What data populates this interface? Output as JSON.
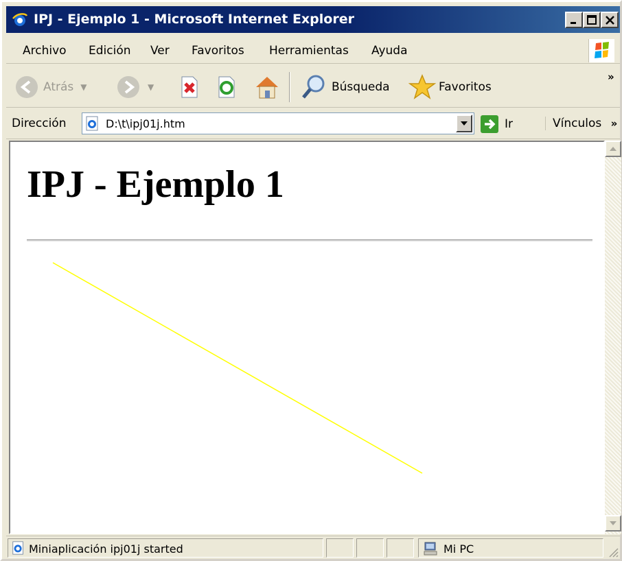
{
  "window": {
    "title": "IPJ - Ejemplo 1 - Microsoft Internet Explorer"
  },
  "menu": {
    "items": [
      "Archivo",
      "Edición",
      "Ver",
      "Favoritos",
      "Herramientas",
      "Ayuda"
    ]
  },
  "toolbar": {
    "back_label": "Atrás",
    "search_label": "Búsqueda",
    "favorites_label": "Favoritos",
    "more": "»"
  },
  "address": {
    "label": "Dirección",
    "url": "D:\\t\\ipj01j.htm",
    "go_label": "Ir",
    "links_label": "Vínculos",
    "more": "»"
  },
  "page": {
    "heading": "IPJ - Ejemplo 1",
    "applet_line_color": "#ffff00"
  },
  "status": {
    "message": "Miniaplicación ipj01j started",
    "zone": "Mi PC"
  },
  "colors": {
    "titlebar": "#0a246a",
    "chrome": "#ece9d8"
  }
}
